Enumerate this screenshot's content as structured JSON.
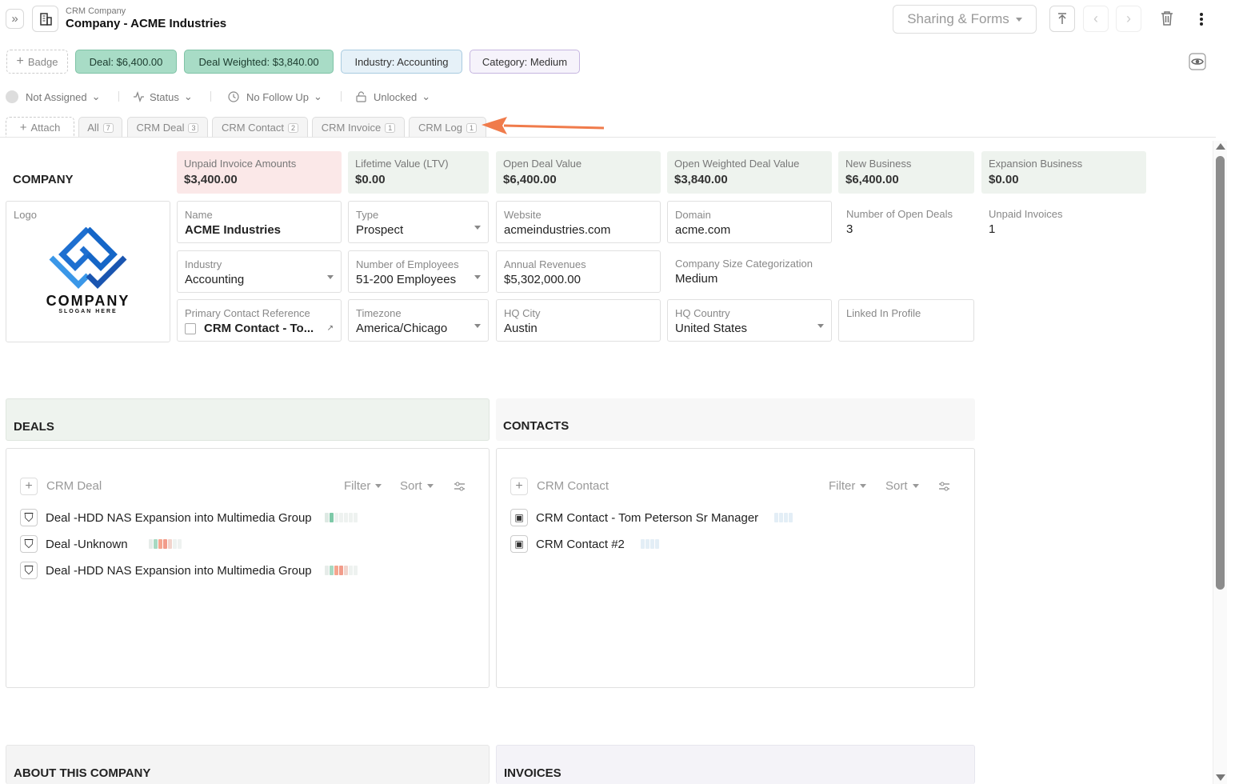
{
  "header": {
    "subtitle": "CRM Company",
    "title": "Company - ACME Industries",
    "sharing_label": "Sharing & Forms"
  },
  "badges": {
    "add_label": "Badge",
    "items": [
      "Deal: $6,400.00",
      "Deal Weighted: $3,840.00",
      "Industry: Accounting",
      "Category: Medium"
    ]
  },
  "props": {
    "assigned": "Not Assigned",
    "status": "Status",
    "follow_up": "No Follow Up",
    "lock": "Unlocked"
  },
  "tabs": {
    "attach": "Attach",
    "items": [
      {
        "label": "All",
        "count": "7"
      },
      {
        "label": "CRM Deal",
        "count": "3"
      },
      {
        "label": "CRM Contact",
        "count": "2"
      },
      {
        "label": "CRM Invoice",
        "count": "1"
      },
      {
        "label": "CRM Log",
        "count": "1"
      }
    ]
  },
  "company_heading": "COMPANY",
  "stats": [
    {
      "label": "Unpaid Invoice Amounts",
      "value": "$3,400.00"
    },
    {
      "label": "Lifetime Value (LTV)",
      "value": "$0.00"
    },
    {
      "label": "Open Deal Value",
      "value": "$6,400.00"
    },
    {
      "label": "Open Weighted Deal Value",
      "value": "$3,840.00"
    },
    {
      "label": "New Business",
      "value": "$6,400.00"
    },
    {
      "label": "Expansion Business",
      "value": "$0.00"
    }
  ],
  "logo": {
    "label": "Logo",
    "company": "COMPANY",
    "slogan": "SLOGAN HERE"
  },
  "fields": {
    "name": {
      "label": "Name",
      "value": "ACME Industries"
    },
    "type": {
      "label": "Type",
      "value": "Prospect"
    },
    "website": {
      "label": "Website",
      "value": "acmeindustries.com"
    },
    "domain": {
      "label": "Domain",
      "value": "acme.com"
    },
    "open_deals": {
      "label": "Number of Open Deals",
      "value": "3"
    },
    "unpaid_invoices": {
      "label": "Unpaid Invoices",
      "value": "1"
    },
    "industry": {
      "label": "Industry",
      "value": "Accounting"
    },
    "employees": {
      "label": "Number of Employees",
      "value": "51-200 Employees"
    },
    "revenues": {
      "label": "Annual Revenues",
      "value": "$5,302,000.00"
    },
    "size_cat": {
      "label": "Company Size Categorization",
      "value": "Medium"
    },
    "primary_contact": {
      "label": "Primary Contact Reference",
      "value": "CRM Contact - To..."
    },
    "timezone": {
      "label": "Timezone",
      "value": "America/Chicago"
    },
    "hq_city": {
      "label": "HQ City",
      "value": "Austin"
    },
    "hq_country": {
      "label": "HQ Country",
      "value": "United States"
    },
    "linkedin": {
      "label": "Linked In Profile",
      "value": ""
    }
  },
  "deals": {
    "heading": "DEALS",
    "placeholder": "CRM Deal",
    "filter": "Filter",
    "sort": "Sort",
    "items": [
      "Deal -HDD NAS Expansion into Multimedia Group",
      "Deal -Unknown",
      "Deal -HDD NAS Expansion into Multimedia Group"
    ]
  },
  "contacts": {
    "heading": "CONTACTS",
    "placeholder": "CRM Contact",
    "filter": "Filter",
    "sort": "Sort",
    "items": [
      "CRM Contact - Tom Peterson Sr Manager",
      "CRM Contact #2"
    ]
  },
  "about": {
    "heading": "ABOUT THIS COMPANY"
  },
  "invoices": {
    "heading": "INVOICES"
  },
  "colors": {
    "accent_green": "#a8dcc6",
    "blue_badge": "#e6f1f8",
    "purple_badge": "#f6f3fb",
    "unpaid_bg": "#fbe8e8",
    "stat_bg": "#eef3ee",
    "arrow": "#f07b4b"
  }
}
